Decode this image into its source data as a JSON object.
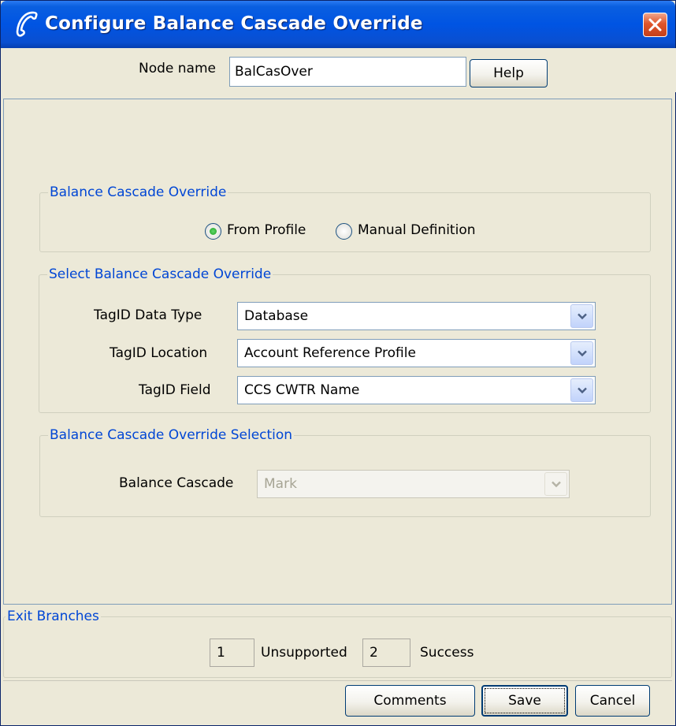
{
  "window": {
    "title": "Configure Balance Cascade Override",
    "icon": "phone-handset-icon"
  },
  "node": {
    "label": "Node name",
    "value": "BalCasOver",
    "help_label": "Help"
  },
  "override": {
    "legend": "Balance Cascade Override",
    "options": [
      {
        "label": "From Profile",
        "selected": true
      },
      {
        "label": "Manual Definition",
        "selected": false
      }
    ]
  },
  "select": {
    "legend": "Select Balance Cascade Override",
    "fields": [
      {
        "label": "TagID Data Type",
        "value": "Database"
      },
      {
        "label": "TagID Location",
        "value": "Account Reference Profile"
      },
      {
        "label": "TagID Field",
        "value": "CCS CWTR Name"
      }
    ]
  },
  "selection": {
    "legend": "Balance Cascade Override Selection",
    "label": "Balance Cascade",
    "value": "Mark",
    "enabled": false
  },
  "exits": {
    "legend": "Exit Branches",
    "branches": [
      {
        "number": "1",
        "label": "Unsupported"
      },
      {
        "number": "2",
        "label": "Success"
      }
    ]
  },
  "buttons": {
    "comments": "Comments",
    "save": "Save",
    "cancel": "Cancel"
  },
  "colors": {
    "title_bar": "#0054e3",
    "legend_text": "#0046d5",
    "window_bg": "#ece9d8",
    "close_button": "#e0552b",
    "radio_selected": "#21a121"
  }
}
